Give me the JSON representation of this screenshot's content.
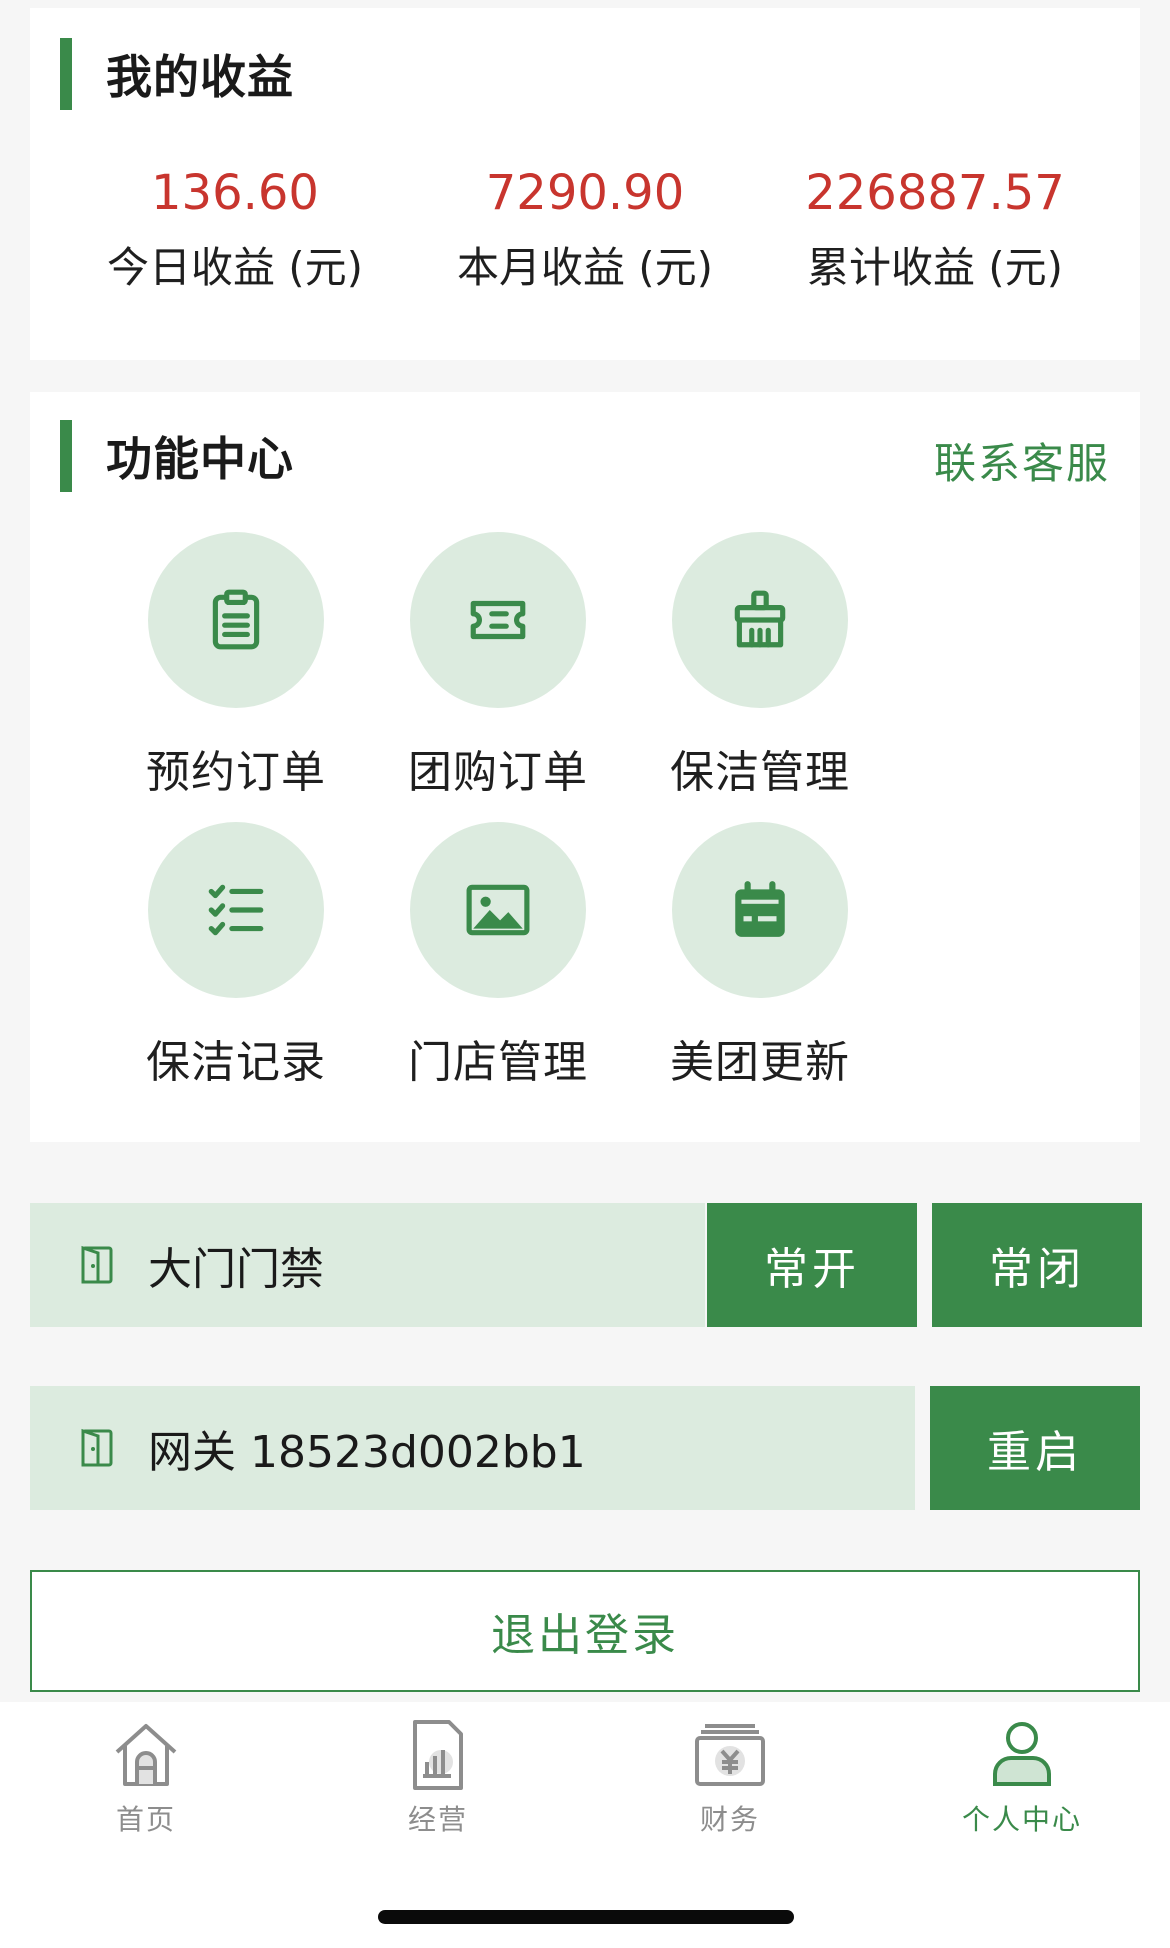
{
  "earnings": {
    "title": "我的收益",
    "items": [
      {
        "value": "136.60",
        "label": "今日收益 (元)"
      },
      {
        "value": "7290.90",
        "label": "本月收益 (元)"
      },
      {
        "value": "226887.57",
        "label": "累计收益 (元)"
      }
    ]
  },
  "functions": {
    "title": "功能中心",
    "contact_label": "联系客服",
    "items": [
      {
        "label": "预约订单",
        "icon": "clipboard-icon"
      },
      {
        "label": "团购订单",
        "icon": "ticket-icon"
      },
      {
        "label": "保洁管理",
        "icon": "broom-icon"
      },
      {
        "label": "保洁记录",
        "icon": "checklist-icon"
      },
      {
        "label": "门店管理",
        "icon": "image-icon"
      },
      {
        "label": "美团更新",
        "icon": "calendar-icon"
      }
    ]
  },
  "door": {
    "label": "大门门禁",
    "icon": "door-icon",
    "open_label": "常开",
    "close_label": "常闭"
  },
  "gateway": {
    "label": "网关 18523d002bb1",
    "icon": "door-icon",
    "restart_label": "重启"
  },
  "logout_label": "退出登录",
  "tabbar": {
    "items": [
      {
        "label": "首页",
        "icon": "home-icon",
        "active": false
      },
      {
        "label": "经营",
        "icon": "chart-doc-icon",
        "active": false
      },
      {
        "label": "财务",
        "icon": "yuan-wallet-icon",
        "active": false
      },
      {
        "label": "个人中心",
        "icon": "user-icon",
        "active": true
      }
    ]
  },
  "colors": {
    "accent": "#3a8a4a",
    "accent_light": "#dcebdf",
    "value_red": "#c8352e",
    "tab_inactive": "#8d8d8d"
  }
}
